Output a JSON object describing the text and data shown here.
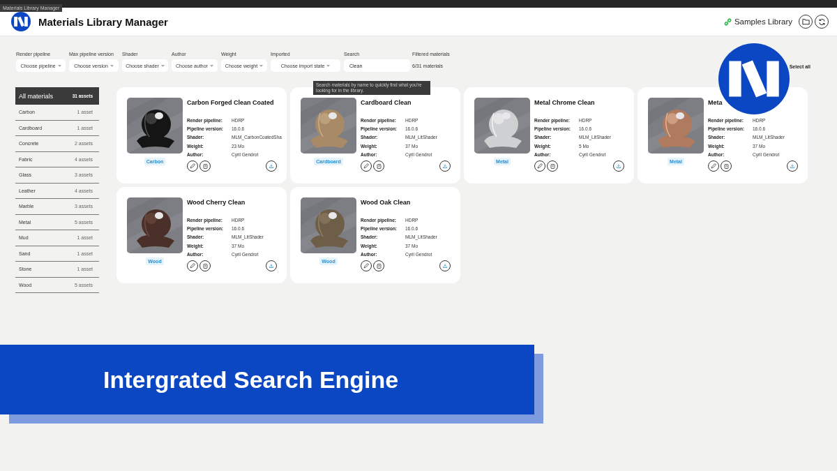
{
  "window": {
    "title": "Materials Library Manager"
  },
  "header": {
    "title": "Materials Library Manager",
    "link": "Samples Library"
  },
  "filters": [
    {
      "label": "Render pipeline",
      "value": "Choose pipeline"
    },
    {
      "label": "Max pipeline version",
      "value": "Choose version"
    },
    {
      "label": "Shader",
      "value": "Choose shader"
    },
    {
      "label": "Author",
      "value": "Choose author"
    },
    {
      "label": "Weight",
      "value": "Choose weight"
    },
    {
      "label": "Imported",
      "value": "Choose import state"
    }
  ],
  "search": {
    "label": "Search",
    "value": "Clean",
    "tooltip": "Search materials by name to quickly find what you're looking for in the library."
  },
  "filtered": {
    "label": "Filtered materials",
    "count": "6/31 materials"
  },
  "select_all": "Select all",
  "sidebar": {
    "items": [
      {
        "label": "All materials",
        "count": "31 assets",
        "selected": true
      },
      {
        "label": "Carbon",
        "count": "1 asset",
        "selected": false
      },
      {
        "label": "Cardboard",
        "count": "1 asset",
        "selected": false
      },
      {
        "label": "Concrete",
        "count": "2 assets",
        "selected": false
      },
      {
        "label": "Fabric",
        "count": "4 assets",
        "selected": false
      },
      {
        "label": "Glass",
        "count": "3 assets",
        "selected": false
      },
      {
        "label": "Leather",
        "count": "4 assets",
        "selected": false
      },
      {
        "label": "Marble",
        "count": "3 assets",
        "selected": false
      },
      {
        "label": "Metal",
        "count": "5 assets",
        "selected": false
      },
      {
        "label": "Mud",
        "count": "1 asset",
        "selected": false
      },
      {
        "label": "Sand",
        "count": "1 asset",
        "selected": false
      },
      {
        "label": "Stone",
        "count": "1 asset",
        "selected": false
      },
      {
        "label": "Wood",
        "count": "5 assets",
        "selected": false
      }
    ]
  },
  "cards": [
    {
      "title": "Carbon Forged Clean Coated",
      "tag": "Carbon",
      "fields": [
        {
          "label": "Render pipeline:",
          "value": "HDRP"
        },
        {
          "label": "Pipeline version:",
          "value": "16.0.6"
        },
        {
          "label": "Shader:",
          "value": "MLM_CarbonCoatedSha"
        },
        {
          "label": "Weight:",
          "value": "23 Mo"
        },
        {
          "label": "Author:",
          "value": "Cyril Gendrot"
        }
      ]
    },
    {
      "title": "Cardboard Clean",
      "tag": "Cardboard",
      "fields": [
        {
          "label": "Render pipeline:",
          "value": "HDRP"
        },
        {
          "label": "Pipeline version:",
          "value": "16.0.6"
        },
        {
          "label": "Shader:",
          "value": "MLM_LitShader"
        },
        {
          "label": "Weight:",
          "value": "37 Mo"
        },
        {
          "label": "Author:",
          "value": "Cyril Gendrot"
        }
      ]
    },
    {
      "title": "Metal Chrome Clean",
      "tag": "Metal",
      "fields": [
        {
          "label": "Render pipeline:",
          "value": "HDRP"
        },
        {
          "label": "Pipeline version:",
          "value": "16.0.6"
        },
        {
          "label": "Shader:",
          "value": "MLM_LitShader"
        },
        {
          "label": "Weight:",
          "value": "5 Mo"
        },
        {
          "label": "Author:",
          "value": "Cyril Gendrot"
        }
      ]
    },
    {
      "title": "Meta",
      "tag": "Metal",
      "fields": [
        {
          "label": "Render pipeline:",
          "value": "HDRP"
        },
        {
          "label": "Pipeline version:",
          "value": "16.0.6"
        },
        {
          "label": "Shader:",
          "value": "MLM_LitShader"
        },
        {
          "label": "Weight:",
          "value": "37 Mo"
        },
        {
          "label": "Author:",
          "value": "Cyril Gendrot"
        }
      ]
    },
    {
      "title": "Wood Cherry Clean",
      "tag": "Wood",
      "fields": [
        {
          "label": "Render pipeline:",
          "value": "HDRP"
        },
        {
          "label": "Pipeline version:",
          "value": "16.0.6"
        },
        {
          "label": "Shader:",
          "value": "MLM_LitShader"
        },
        {
          "label": "Weight:",
          "value": "37 Mo"
        },
        {
          "label": "Author:",
          "value": "Cyril Gendrot"
        }
      ]
    },
    {
      "title": "Wood Oak Clean",
      "tag": "Wood",
      "fields": [
        {
          "label": "Render pipeline:",
          "value": "HDRP"
        },
        {
          "label": "Pipeline version:",
          "value": "16.0.6"
        },
        {
          "label": "Shader:",
          "value": "MLM_LitShader"
        },
        {
          "label": "Weight:",
          "value": "37 Mo"
        },
        {
          "label": "Author:",
          "value": "Cyril Gendrot"
        }
      ]
    }
  ],
  "banner": {
    "text": "Intergrated Search Engine"
  }
}
